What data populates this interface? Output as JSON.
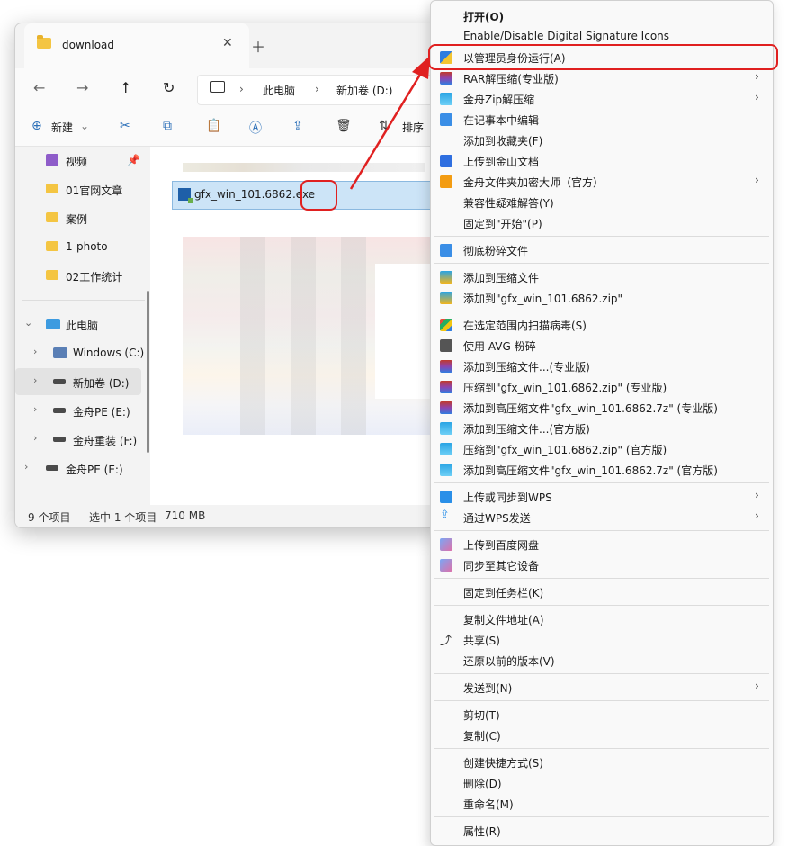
{
  "explorer": {
    "tab_title": "download",
    "address": [
      "此电脑",
      "新加卷 (D:)"
    ],
    "toolbar": {
      "new_label": "新建",
      "sort_label": "排序"
    },
    "sidebar": [
      {
        "label": "视频",
        "pinned": true
      },
      {
        "label": "01官网文章"
      },
      {
        "label": "案例"
      },
      {
        "label": "1-photo"
      },
      {
        "label": "02工作统计"
      },
      {
        "label": "此电脑"
      },
      {
        "label": "Windows (C:)"
      },
      {
        "label": "新加卷 (D:)"
      },
      {
        "label": "金舟PE (E:)"
      },
      {
        "label": "金舟重装 (F:)"
      },
      {
        "label": "金舟PE (E:)"
      }
    ],
    "file_name": "gfx_win_101.6862.exe",
    "status": {
      "count": "9 个项目",
      "selected": "选中 1 个项目",
      "size": "710 MB"
    }
  },
  "menu": {
    "items": [
      {
        "label": "打开(O)",
        "bold": true
      },
      {
        "label": "Enable/Disable Digital Signature Icons"
      },
      {
        "label": "以管理员身份运行(A)",
        "icon": "shield-icon"
      },
      {
        "label": "RAR解压缩(专业版)",
        "icon": "rar-icon",
        "submenu": true
      },
      {
        "label": "金舟Zip解压缩",
        "icon": "zip-icon",
        "submenu": true
      },
      {
        "label": "在记事本中编辑",
        "icon": "notepad-icon"
      },
      {
        "label": "添加到收藏夹(F)"
      },
      {
        "label": "上传到金山文档",
        "icon": "kdocs-icon"
      },
      {
        "label": "金舟文件夹加密大师（官方）",
        "icon": "lock-folder-icon",
        "submenu": true
      },
      {
        "label": "兼容性疑难解答(Y)"
      },
      {
        "label": "固定到\"开始\"(P)"
      },
      {
        "label": "彻底粉碎文件",
        "icon": "shred-icon"
      },
      {
        "label": "添加到压缩文件",
        "icon": "archive-icon"
      },
      {
        "label": "添加到\"gfx_win_101.6862.zip\"",
        "icon": "archive-icon"
      },
      {
        "label": "在选定范围内扫描病毒(S)",
        "icon": "avg-icon"
      },
      {
        "label": "使用 AVG 粉碎",
        "icon": "avg-shred-icon"
      },
      {
        "label": "添加到压缩文件...(专业版)",
        "icon": "rar-icon"
      },
      {
        "label": "压缩到\"gfx_win_101.6862.zip\" (专业版)",
        "icon": "rar-icon"
      },
      {
        "label": "添加到高压缩文件\"gfx_win_101.6862.7z\" (专业版)",
        "icon": "rar-icon"
      },
      {
        "label": "添加到压缩文件...(官方版)",
        "icon": "zip-icon"
      },
      {
        "label": "压缩到\"gfx_win_101.6862.zip\" (官方版)",
        "icon": "zip-icon"
      },
      {
        "label": "添加到高压缩文件\"gfx_win_101.6862.7z\" (官方版)",
        "icon": "zip-icon"
      },
      {
        "label": "上传或同步到WPS",
        "icon": "cloud-icon",
        "submenu": true
      },
      {
        "label": "通过WPS发送",
        "icon": "send-icon",
        "submenu": true
      },
      {
        "label": "上传到百度网盘",
        "icon": "baidu-icon"
      },
      {
        "label": "同步至其它设备",
        "icon": "baidu-icon"
      },
      {
        "label": "固定到任务栏(K)"
      },
      {
        "label": "复制文件地址(A)"
      },
      {
        "label": "共享(S)",
        "icon": "share-icon"
      },
      {
        "label": "还原以前的版本(V)"
      },
      {
        "label": "发送到(N)",
        "submenu": true
      },
      {
        "label": "剪切(T)"
      },
      {
        "label": "复制(C)"
      },
      {
        "label": "创建快捷方式(S)"
      },
      {
        "label": "删除(D)"
      },
      {
        "label": "重命名(M)"
      },
      {
        "label": "属性(R)"
      }
    ]
  }
}
